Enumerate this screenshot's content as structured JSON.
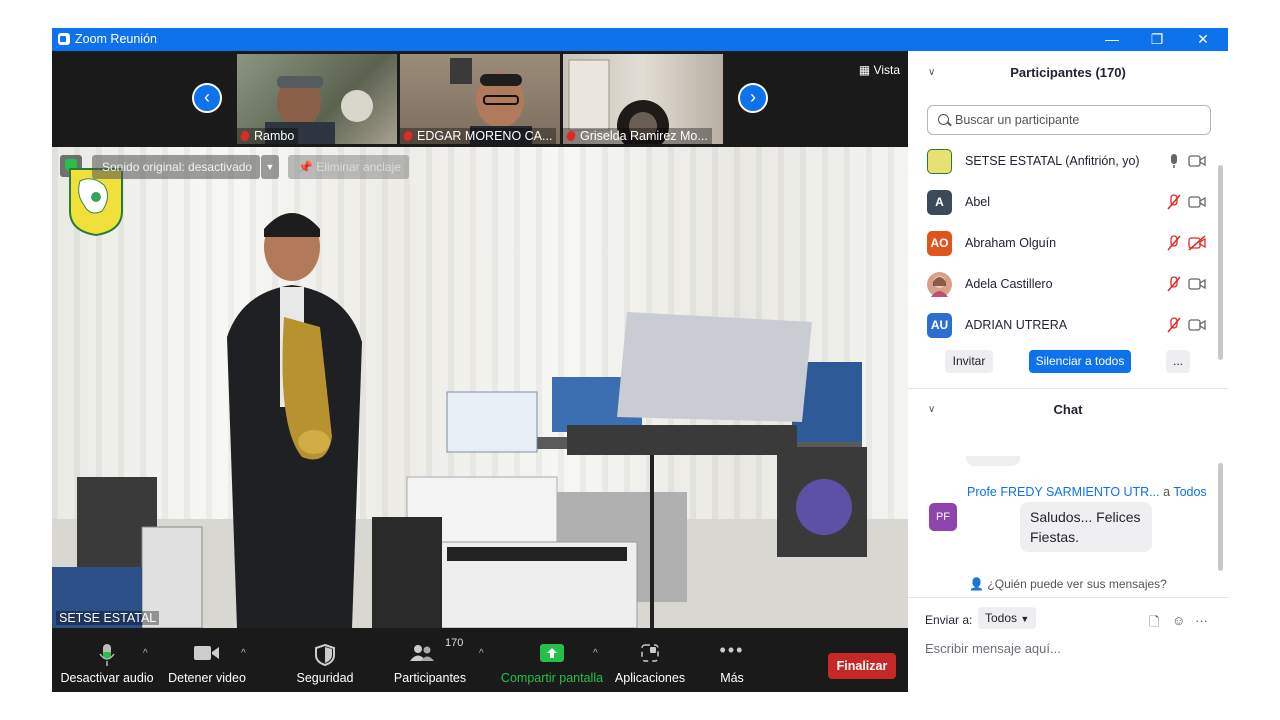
{
  "window": {
    "title": "Zoom Reunión",
    "controls": [
      "—",
      "❐",
      "✕"
    ]
  },
  "video": {
    "view_label": "Vista",
    "thumbnails": [
      {
        "name": "Rambo",
        "bg": "#6d7566"
      },
      {
        "name": "EDGAR MORENO CA...",
        "bg": "#8a7a68"
      },
      {
        "name": "Griselda Ramirez Mo...",
        "bg": "#b9b2a8"
      }
    ],
    "sound_original": "Sonido original: desactivado",
    "unpin": "Eliminar anclaje",
    "speaker_name": "SETSE ESTATAL"
  },
  "toolbar": {
    "mute": "Desactivar audio",
    "stop_video": "Detener video",
    "security": "Seguridad",
    "participants": "Participantes",
    "participant_count": "170",
    "share": "Compartir pantalla",
    "apps": "Aplicaciones",
    "more": "Más",
    "end": "Finalizar"
  },
  "participants_panel": {
    "header": "Participantes (170)",
    "search_placeholder": "Buscar un participante",
    "list": [
      {
        "initials": "",
        "name": "SETSE ESTATAL (Anfitrión, yo)",
        "color": "#e8e070",
        "mic": "on",
        "cam": "on"
      },
      {
        "initials": "A",
        "name": "Abel",
        "color": "#3b4a5a",
        "mic": "muted",
        "cam": "on"
      },
      {
        "initials": "AO",
        "name": "Abraham Olguín",
        "color": "#e0551e",
        "mic": "muted",
        "cam": "off"
      },
      {
        "initials": "",
        "name": "Adela Castillero",
        "color": "#d8a08a",
        "mic": "muted",
        "cam": "on"
      },
      {
        "initials": "AU",
        "name": "ADRIAN UTRERA",
        "color": "#2d6fd1",
        "mic": "muted",
        "cam": "on"
      }
    ],
    "invite": "Invitar",
    "mute_all": "Silenciar a todos",
    "more": "..."
  },
  "chat_panel": {
    "header": "Chat",
    "message": {
      "from": "Profe FREDY SARMIENTO UTR...",
      "to_prefix": "a",
      "to": "Todos",
      "avatar": "PF",
      "text": "Saludos... Felices Fiestas."
    },
    "who_sees": "¿Quién puede ver sus mensajes?",
    "send_to_label": "Enviar a:",
    "send_to_value": "Todos",
    "input_placeholder": "Escribir mensaje aquí..."
  },
  "colors": {
    "accent": "#0e72ed",
    "end": "#c62828",
    "share": "#24c04a",
    "muted": "#e02828"
  }
}
